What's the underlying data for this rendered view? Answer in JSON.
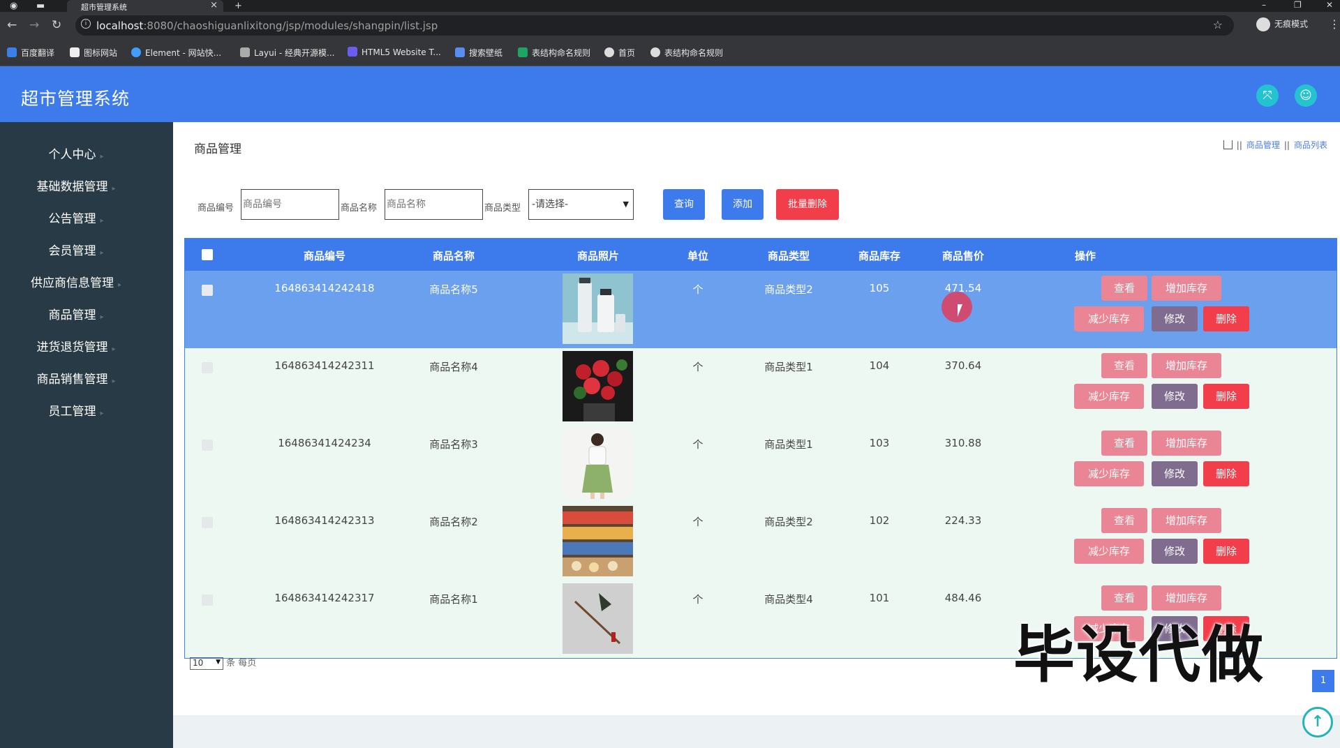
{
  "browser": {
    "tab_title": "超市管理系统",
    "url_host": "localhost",
    "url_path": ":8080/chaoshiguanlixitong/jsp/modules/shangpin/list.jsp",
    "incognito_label": "无痕模式",
    "bookmarks": [
      "百度翻译",
      "图标网站",
      "Element - 网站快...",
      "Layui - 经典开源模...",
      "HTML5 Website T...",
      "搜索壁纸",
      "表结构命名规则",
      "首页",
      "表结构命名规则"
    ]
  },
  "app": {
    "title": "超市管理系统"
  },
  "sidebar": {
    "items": [
      "个人中心",
      "基础数据管理",
      "公告管理",
      "会员管理",
      "供应商信息管理",
      "商品管理",
      "进货退货管理",
      "商品销售管理",
      "员工管理"
    ]
  },
  "main": {
    "page_title": "商品管理",
    "breadcrumb": [
      "商品管理",
      "商品列表"
    ]
  },
  "search": {
    "code_label": "商品编号",
    "code_placeholder": "商品编号",
    "name_label": "商品名称",
    "name_placeholder": "商品名称",
    "type_label": "商品类型",
    "type_selected": "-请选择-",
    "query_label": "查询",
    "add_label": "添加",
    "batch_delete_label": "批量删除"
  },
  "table": {
    "headers": [
      "商品编号",
      "商品名称",
      "商品照片",
      "单位",
      "商品类型",
      "商品库存",
      "商品售价",
      "操作"
    ],
    "actions": {
      "view": "查看",
      "add_stock": "增加库存",
      "reduce_stock": "减少库存",
      "edit": "修改",
      "delete": "删除"
    },
    "rows": [
      {
        "code": "164863414242418",
        "name": "商品名称5",
        "unit": "个",
        "type": "商品类型2",
        "stock": "105",
        "price": "471.54"
      },
      {
        "code": "164863414242311",
        "name": "商品名称4",
        "unit": "个",
        "type": "商品类型1",
        "stock": "104",
        "price": "370.64"
      },
      {
        "code": "16486341424234",
        "name": "商品名称3",
        "unit": "个",
        "type": "商品类型1",
        "stock": "103",
        "price": "310.88"
      },
      {
        "code": "164863414242313",
        "name": "商品名称2",
        "unit": "个",
        "type": "商品类型2",
        "stock": "102",
        "price": "224.33"
      },
      {
        "code": "164863414242317",
        "name": "商品名称1",
        "unit": "个",
        "type": "商品类型4",
        "stock": "101",
        "price": "484.46"
      }
    ]
  },
  "pager": {
    "per_page": "10",
    "per_page_suffix": "条 每页",
    "current_page": "1"
  },
  "watermark": "毕设代做",
  "colors": {
    "primary": "#3d7bec",
    "sidebar": "#283a46",
    "pink": "#e98594",
    "purple": "#7f6c8f",
    "red": "#f23e4a"
  }
}
